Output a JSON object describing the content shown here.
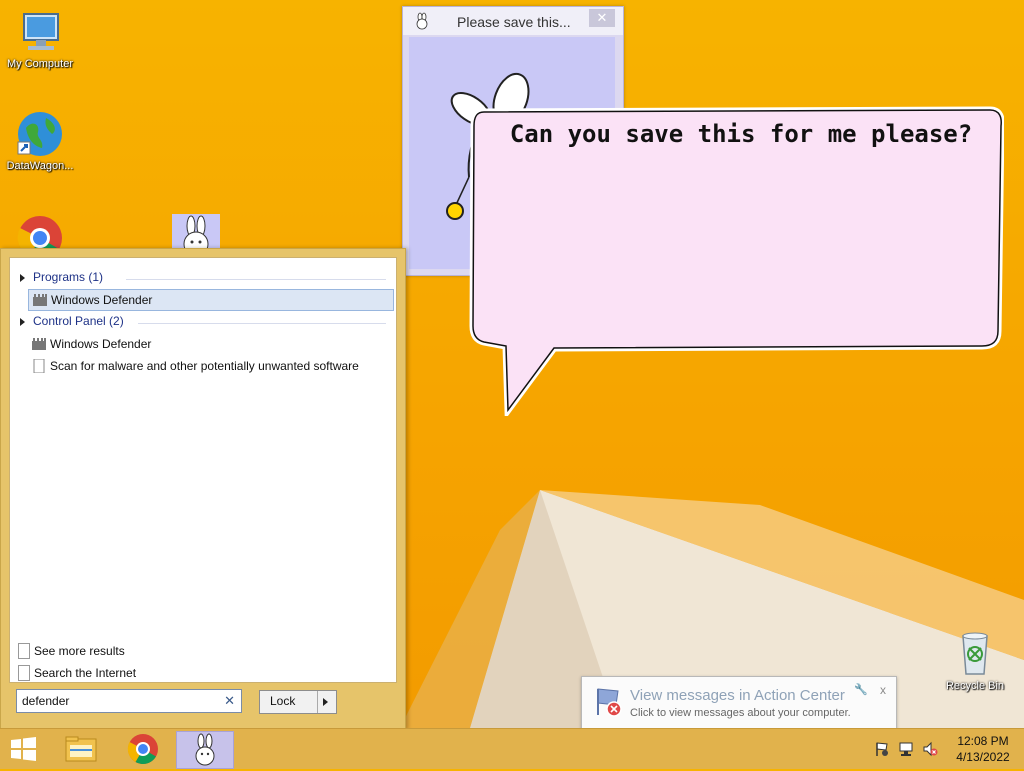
{
  "desktop_icons": {
    "my_computer": "My Computer",
    "datawagon": "DataWagon...",
    "chrome": "",
    "bunny": "",
    "recycle_bin": "Recycle Bin"
  },
  "bunny_window": {
    "title": "Please save this...",
    "close": "✕"
  },
  "speech_bubble": {
    "text": "Can you save this for me please?"
  },
  "start_search": {
    "groups": [
      {
        "header": "Programs (1)",
        "items": [
          {
            "label": "Windows Defender",
            "icon": "windows-defender-icon",
            "selected": true
          }
        ]
      },
      {
        "header": "Control Panel (2)",
        "items": [
          {
            "label": "Windows Defender",
            "icon": "windows-defender-icon"
          },
          {
            "label": "Scan for malware and other potentially unwanted software",
            "icon": "document-icon"
          }
        ]
      }
    ],
    "see_more": "See more results",
    "search_internet": "Search the Internet",
    "query": "defender",
    "clear": "✕",
    "power_button": "Lock"
  },
  "action_center_balloon": {
    "title": "View messages in Action Center",
    "subtitle": "Click to view messages about your computer.",
    "close": "x"
  },
  "taskbar": {
    "clock_time": "12:08 PM",
    "clock_date": "4/13/2022"
  },
  "colors": {
    "wallpaper": "#f6a400",
    "taskbar": "#e1b24c",
    "bubble_fill": "#fbe2f6",
    "bunny_client": "#c9c8f6"
  }
}
